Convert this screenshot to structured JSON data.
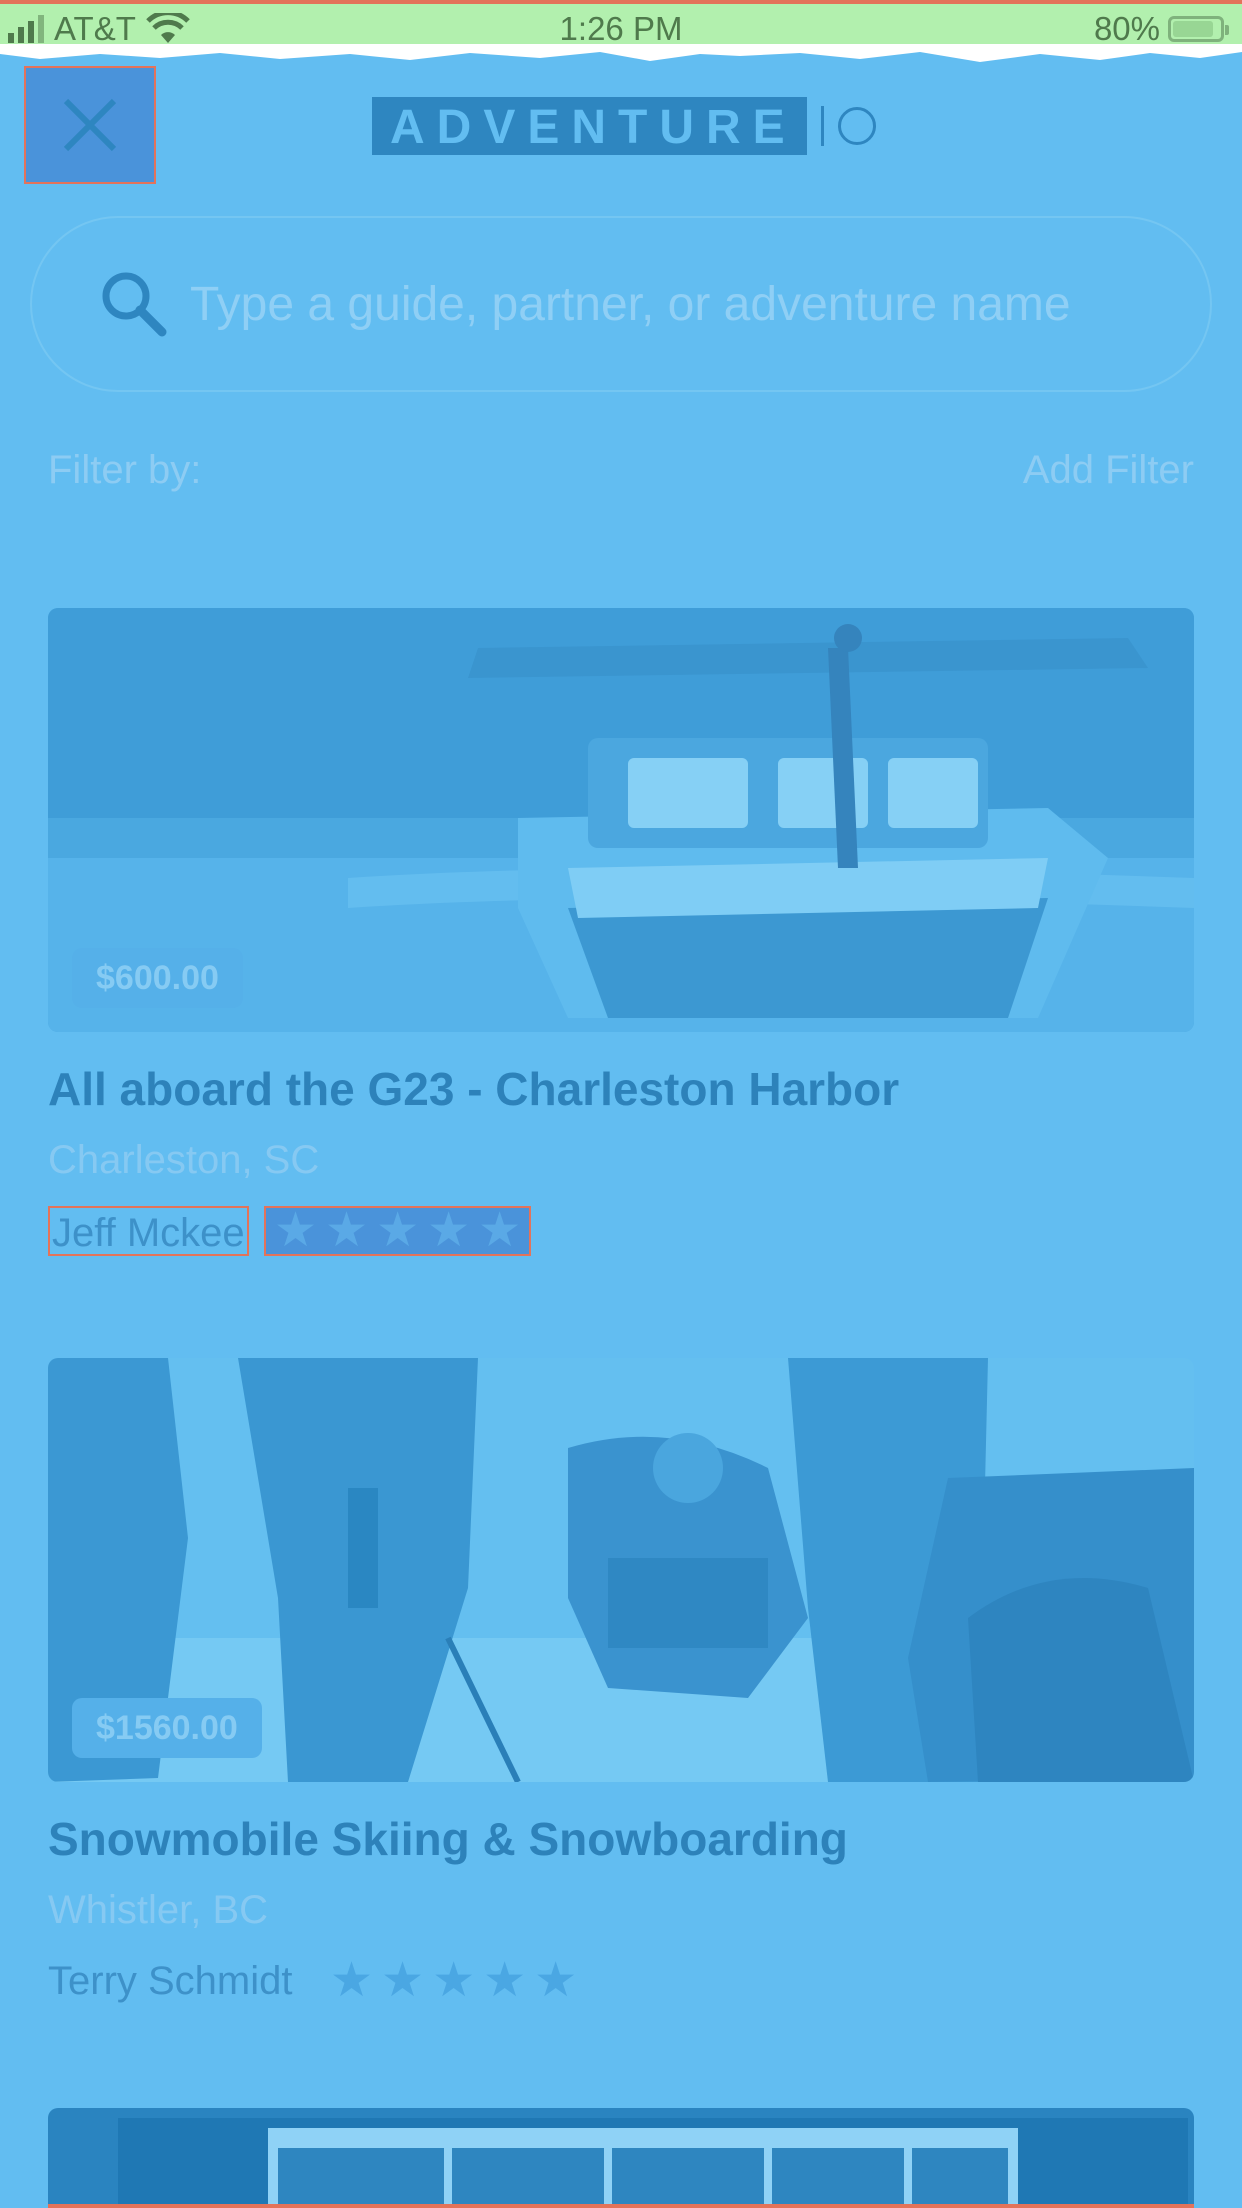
{
  "status_bar": {
    "carrier": "AT&T",
    "time": "1:26 PM",
    "battery": "80%",
    "battery_level": 0.8
  },
  "header": {
    "close_icon": "close-icon",
    "logo_text": "ADVENTURE"
  },
  "search": {
    "placeholder": "Type a guide, partner, or adventure name",
    "icon": "search-icon"
  },
  "filter": {
    "label": "Filter by:",
    "add_label": "Add Filter"
  },
  "cards": [
    {
      "price": "$600.00",
      "title": "All aboard the G23 - Charleston Harbor",
      "location": "Charleston, SC",
      "host": "Jeff Mckee",
      "rating": 5,
      "image": "boat-photo"
    },
    {
      "price": "$1560.00",
      "title": "Snowmobile Skiing & Snowboarding",
      "location": "Whistler, BC",
      "host": "Terry Schmidt",
      "rating": 5,
      "image": "snowmobile-photo"
    },
    {
      "image": "interior-photo"
    }
  ],
  "colors": {
    "background": "#62bdf1",
    "accent": "#2e86c0",
    "status_bar": "#b2f0ae",
    "highlight": "#4a93da",
    "outline": "#e3735a"
  }
}
